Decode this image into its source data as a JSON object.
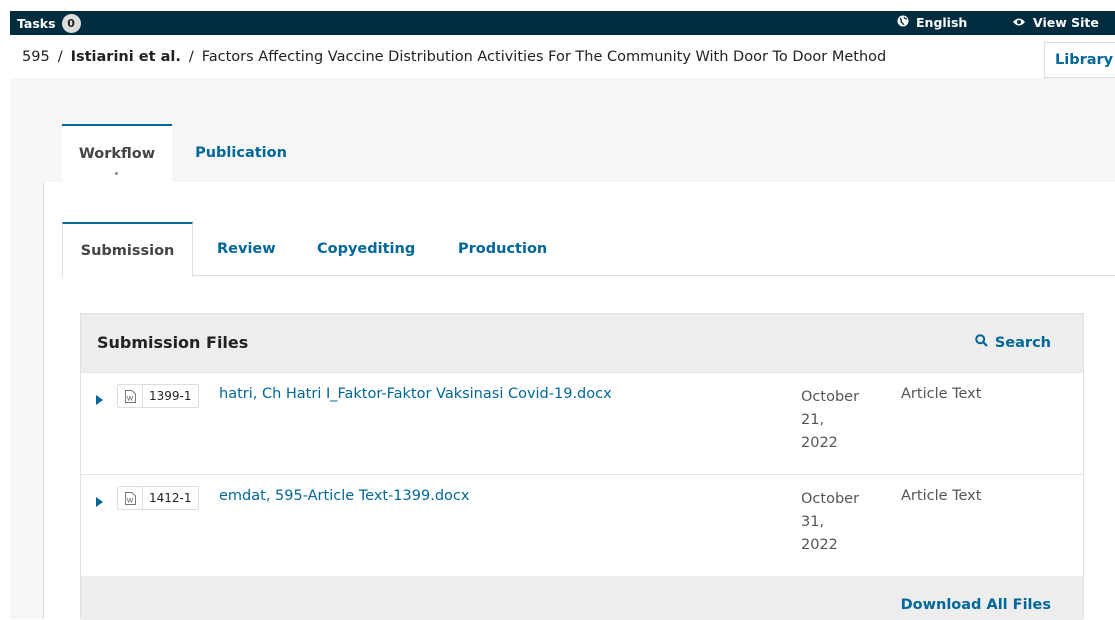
{
  "topbar": {
    "tasks_label": "Tasks",
    "tasks_count": "0",
    "language_label": "English",
    "view_site_label": "View Site"
  },
  "breadcrumb": {
    "id": "595",
    "separator": "/",
    "authors": "Istiarini et al.",
    "title": "Factors Affecting Vaccine Distribution Activities For The Community With Door To Door Method"
  },
  "library_button": "Library",
  "outer_tabs": [
    {
      "label": "Workflow",
      "active": true
    },
    {
      "label": "Publication",
      "active": false
    }
  ],
  "inner_tabs": [
    {
      "label": "Submission",
      "active": true
    },
    {
      "label": "Review",
      "active": false
    },
    {
      "label": "Copyediting",
      "active": false
    },
    {
      "label": "Production",
      "active": false
    }
  ],
  "files_grid": {
    "title": "Submission Files",
    "search_label": "Search",
    "rows": [
      {
        "id": "1399-1",
        "name": "hatri, Ch Hatri I_Faktor-Faktor Vaksinasi Covid-19.docx",
        "date_line1": "October",
        "date_line2": "21,",
        "date_line3": "2022",
        "type": "Article Text"
      },
      {
        "id": "1412-1",
        "name": "emdat, 595-Article Text-1399.docx",
        "date_line1": "October",
        "date_line2": "31,",
        "date_line3": "2022",
        "type": "Article Text"
      }
    ],
    "download_all_label": "Download All Files"
  },
  "colors": {
    "topbar_bg": "#002c40",
    "link": "#006798",
    "page_bg": "#f6f6f6"
  }
}
